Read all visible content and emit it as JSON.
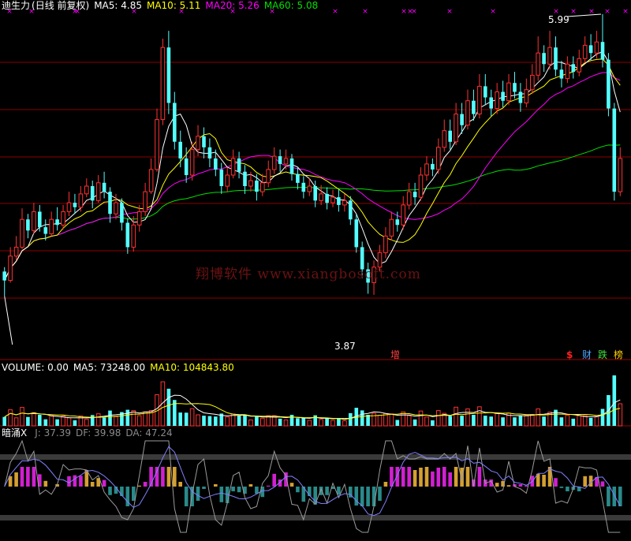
{
  "colors": {
    "background": "#000000",
    "up": "#ff3232",
    "down": "#54ffff",
    "ma5": "#ffffff",
    "ma10": "#ffff00",
    "ma20": "#ff00ff",
    "ma60": "#00e000",
    "grid": "#8b0000",
    "marker": "#ff00ff"
  },
  "price_panel": {
    "stock": "迪生力",
    "mode": "(日线 前复权)",
    "ma5": "MA5: 4.85",
    "ma10": "MA10: 5.11",
    "ma20": "MA20: 5.26",
    "ma60": "MA60: 5.08",
    "high_label": "5.99",
    "low_label": "3.87",
    "badge_zeng": "增",
    "badge_dollar": "$",
    "badge_cai": "财",
    "badge_die": "跌",
    "badge_bang": "榜",
    "watermark": "翔博软件 www.xiangbosoft.com"
  },
  "volume_panel": {
    "title": "VOLUME: 0.00",
    "ma5": "MA5: 73248.00",
    "ma10": "MA10: 104843.80"
  },
  "indicator_panel": {
    "name": "暗涌X",
    "j": "J: 37.39",
    "df": "DF: 39.98",
    "da": "DA: 47.24"
  },
  "chart_data": {
    "type": "candlestick",
    "price_range": [
      3.4,
      6.4
    ],
    "high_marker": 5.99,
    "low_marker": 3.87,
    "ma_latest": {
      "MA5": 4.85,
      "MA10": 5.11,
      "MA20": 5.26,
      "MA60": 5.08
    },
    "candles": [
      [
        4.08,
        4.0,
        4.12,
        3.86
      ],
      [
        4.0,
        4.22,
        4.3,
        3.98
      ],
      [
        4.22,
        4.3,
        4.4,
        4.18
      ],
      [
        4.3,
        4.55,
        4.65,
        4.28
      ],
      [
        4.55,
        4.45,
        4.6,
        4.38
      ],
      [
        4.45,
        4.62,
        4.7,
        4.42
      ],
      [
        4.62,
        4.48,
        4.68,
        4.44
      ],
      [
        4.48,
        4.42,
        4.55,
        4.36
      ],
      [
        4.42,
        4.55,
        4.62,
        4.4
      ],
      [
        4.55,
        4.5,
        4.66,
        4.45
      ],
      [
        4.5,
        4.62,
        4.68,
        4.46
      ],
      [
        4.62,
        4.7,
        4.8,
        4.58
      ],
      [
        4.7,
        4.66,
        4.78,
        4.6
      ],
      [
        4.66,
        4.78,
        4.85,
        4.62
      ],
      [
        4.78,
        4.85,
        4.92,
        4.75
      ],
      [
        4.85,
        4.72,
        4.9,
        4.65
      ],
      [
        4.72,
        4.88,
        4.95,
        4.7
      ],
      [
        4.88,
        4.8,
        4.98,
        4.74
      ],
      [
        4.8,
        4.6,
        4.84,
        4.52
      ],
      [
        4.6,
        4.7,
        4.78,
        4.55
      ],
      [
        4.7,
        4.52,
        4.74,
        4.45
      ],
      [
        4.52,
        4.3,
        4.56,
        4.24
      ],
      [
        4.3,
        4.5,
        4.58,
        4.26
      ],
      [
        4.5,
        4.62,
        4.68,
        4.44
      ],
      [
        4.62,
        4.8,
        4.88,
        4.58
      ],
      [
        4.8,
        5.0,
        5.1,
        4.78
      ],
      [
        5.0,
        5.45,
        5.55,
        4.98
      ],
      [
        5.45,
        6.1,
        6.18,
        5.4
      ],
      [
        6.1,
        5.6,
        6.25,
        5.5
      ],
      [
        5.6,
        5.25,
        5.7,
        5.18
      ],
      [
        5.25,
        5.1,
        5.35,
        5.02
      ],
      [
        5.1,
        4.95,
        5.2,
        4.88
      ],
      [
        4.95,
        5.18,
        5.25,
        4.9
      ],
      [
        5.18,
        5.3,
        5.4,
        5.12
      ],
      [
        5.3,
        5.2,
        5.38,
        5.1
      ],
      [
        5.2,
        5.1,
        5.28,
        5.02
      ],
      [
        5.1,
        5.0,
        5.18,
        4.94
      ],
      [
        5.0,
        4.85,
        5.06,
        4.78
      ],
      [
        4.85,
        4.95,
        5.02,
        4.8
      ],
      [
        4.95,
        5.1,
        5.18,
        4.92
      ],
      [
        5.1,
        4.98,
        5.16,
        4.92
      ],
      [
        4.98,
        4.85,
        5.04,
        4.78
      ],
      [
        4.85,
        4.9,
        4.98,
        4.8
      ],
      [
        4.9,
        4.8,
        4.96,
        4.72
      ],
      [
        4.8,
        4.88,
        4.96,
        4.76
      ],
      [
        4.88,
        5.0,
        5.08,
        4.84
      ],
      [
        5.0,
        5.12,
        5.2,
        4.96
      ],
      [
        5.12,
        5.05,
        5.18,
        4.98
      ],
      [
        5.05,
        5.1,
        5.18,
        5.0
      ],
      [
        5.1,
        4.96,
        5.14,
        4.9
      ],
      [
        4.96,
        4.88,
        5.02,
        4.82
      ],
      [
        4.88,
        4.8,
        4.94,
        4.74
      ],
      [
        4.8,
        4.85,
        4.92,
        4.76
      ],
      [
        4.85,
        4.72,
        4.9,
        4.66
      ],
      [
        4.72,
        4.78,
        4.86,
        4.68
      ],
      [
        4.78,
        4.7,
        4.84,
        4.64
      ],
      [
        4.7,
        4.75,
        4.82,
        4.66
      ],
      [
        4.75,
        4.68,
        4.82,
        4.62
      ],
      [
        4.68,
        4.72,
        4.78,
        4.62
      ],
      [
        4.72,
        4.55,
        4.76,
        4.5
      ],
      [
        4.55,
        4.3,
        4.6,
        4.25
      ],
      [
        4.3,
        4.1,
        4.35,
        4.02
      ],
      [
        4.1,
        3.98,
        4.16,
        3.88
      ],
      [
        3.98,
        4.12,
        4.18,
        3.87
      ],
      [
        4.12,
        4.25,
        4.32,
        4.08
      ],
      [
        4.25,
        4.4,
        4.48,
        4.2
      ],
      [
        4.4,
        4.55,
        4.62,
        4.36
      ],
      [
        4.55,
        4.5,
        4.62,
        4.44
      ],
      [
        4.5,
        4.68,
        4.76,
        4.46
      ],
      [
        4.68,
        4.8,
        4.88,
        4.64
      ],
      [
        4.8,
        4.75,
        4.88,
        4.68
      ],
      [
        4.75,
        4.95,
        5.02,
        4.72
      ],
      [
        4.95,
        5.05,
        5.12,
        4.9
      ],
      [
        5.05,
        5.0,
        5.1,
        4.94
      ],
      [
        5.0,
        5.2,
        5.28,
        4.96
      ],
      [
        5.2,
        5.35,
        5.45,
        5.16
      ],
      [
        5.35,
        5.25,
        5.45,
        5.18
      ],
      [
        5.25,
        5.5,
        5.6,
        5.22
      ],
      [
        5.5,
        5.4,
        5.6,
        5.32
      ],
      [
        5.4,
        5.62,
        5.72,
        5.36
      ],
      [
        5.62,
        5.5,
        5.72,
        5.44
      ],
      [
        5.5,
        5.75,
        5.86,
        5.46
      ],
      [
        5.75,
        5.65,
        5.86,
        5.58
      ],
      [
        5.65,
        5.55,
        5.72,
        5.48
      ],
      [
        5.55,
        5.7,
        5.78,
        5.5
      ],
      [
        5.7,
        5.62,
        5.8,
        5.56
      ],
      [
        5.62,
        5.78,
        5.86,
        5.58
      ],
      [
        5.78,
        5.7,
        5.88,
        5.64
      ],
      [
        5.7,
        5.6,
        5.78,
        5.52
      ],
      [
        5.6,
        5.72,
        5.82,
        5.56
      ],
      [
        5.72,
        5.85,
        5.95,
        5.68
      ],
      [
        5.85,
        6.05,
        6.2,
        5.8
      ],
      [
        6.05,
        5.95,
        6.12,
        5.88
      ],
      [
        5.95,
        6.1,
        6.25,
        5.9
      ],
      [
        6.1,
        5.9,
        6.2,
        5.84
      ],
      [
        5.9,
        5.82,
        5.98,
        5.74
      ],
      [
        5.82,
        5.95,
        6.02,
        5.78
      ],
      [
        5.95,
        5.88,
        6.02,
        5.82
      ],
      [
        5.88,
        6.0,
        6.08,
        5.84
      ],
      [
        6.0,
        6.12,
        6.2,
        5.96
      ],
      [
        6.12,
        6.05,
        6.22,
        5.98
      ],
      [
        6.05,
        6.15,
        6.25,
        6.0
      ],
      [
        6.15,
        5.99,
        6.4,
        5.92
      ],
      [
        5.99,
        5.55,
        6.05,
        5.48
      ],
      [
        5.55,
        4.8,
        5.6,
        4.72
      ],
      [
        4.8,
        5.1,
        5.2,
        4.76
      ]
    ]
  }
}
